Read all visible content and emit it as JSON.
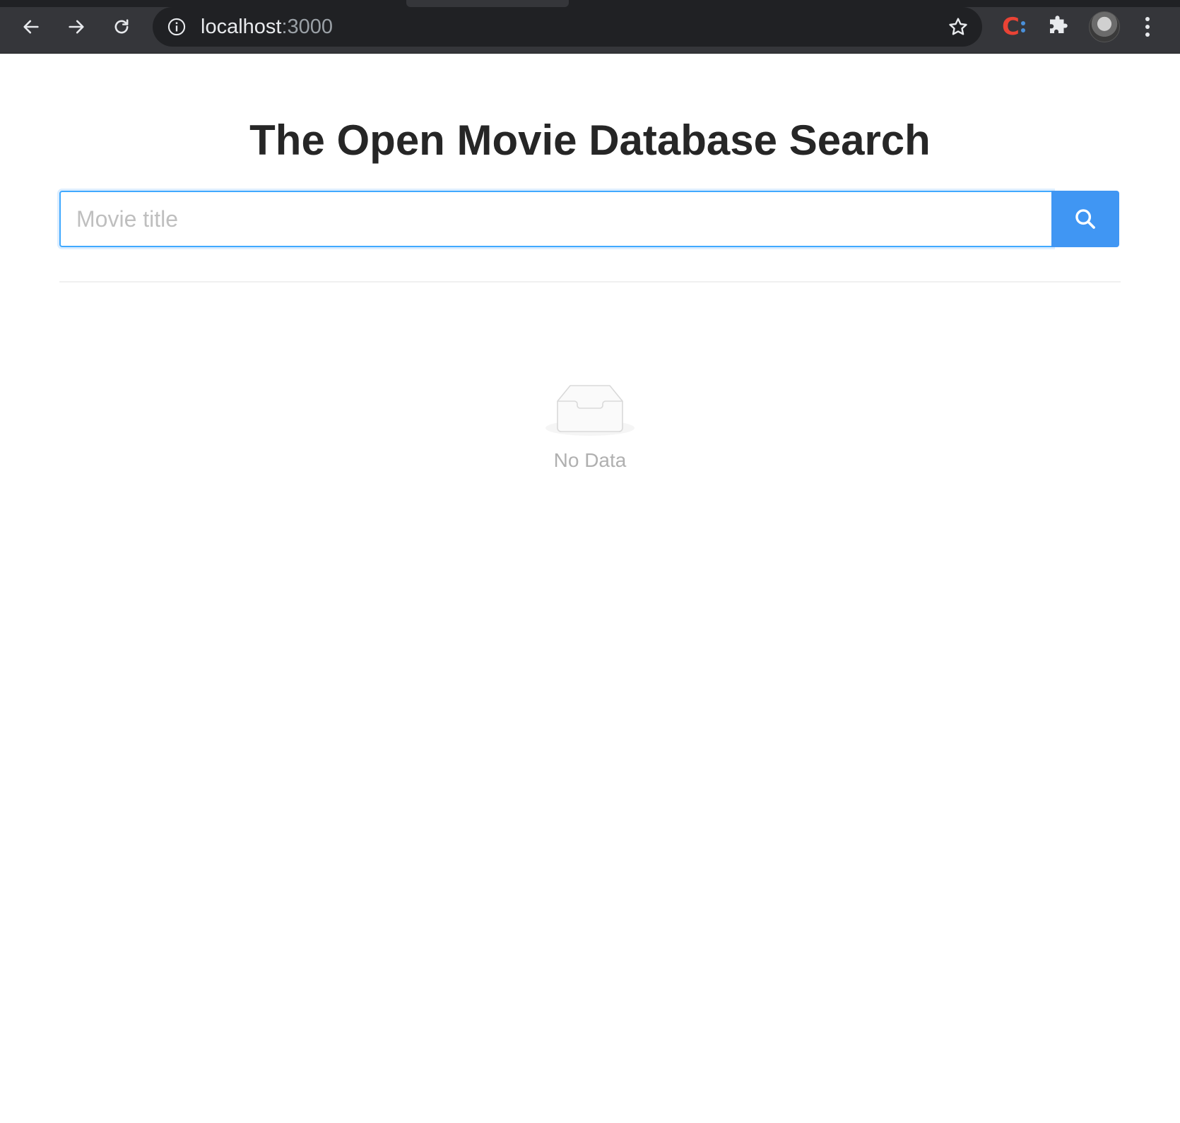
{
  "browser": {
    "url_host": "localhost",
    "url_port": ":3000",
    "back_icon": "back-arrow-icon",
    "forward_icon": "forward-arrow-icon",
    "reload_icon": "reload-icon",
    "info_icon": "info-icon",
    "bookmark_icon": "star-icon",
    "extension_icon": "extension-c-icon",
    "extensions_menu_icon": "puzzle-icon",
    "menu_icon": "kebab-menu-icon"
  },
  "page": {
    "title": "The Open Movie Database Search",
    "search": {
      "placeholder": "Movie title",
      "value": "",
      "button_icon": "search-icon"
    },
    "empty_state": {
      "icon": "empty-inbox-icon",
      "text": "No Data"
    }
  },
  "colors": {
    "chrome_bg": "#35363a",
    "omnibox_bg": "#202124",
    "primary": "#4096f3",
    "focus_border": "#40a9ff",
    "title_text": "#262626",
    "placeholder_text": "#bfbfbf",
    "empty_text": "#b0b0b0"
  }
}
